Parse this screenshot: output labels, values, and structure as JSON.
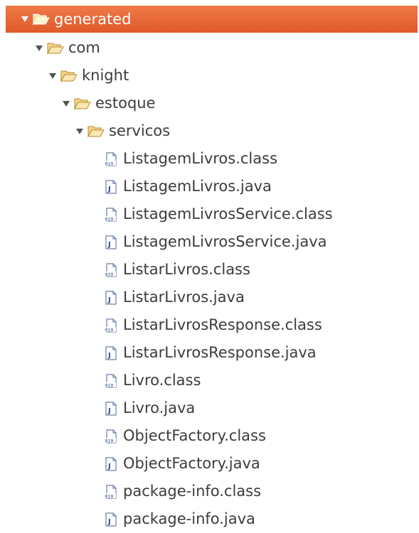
{
  "tree": {
    "root": {
      "label": "generated",
      "icon": "folder-open-icon",
      "expanded": true,
      "selected": true
    },
    "com": {
      "label": "com",
      "icon": "folder-open-icon",
      "expanded": true
    },
    "knight": {
      "label": "knight",
      "icon": "folder-open-icon",
      "expanded": true
    },
    "estoque": {
      "label": "estoque",
      "icon": "folder-open-icon",
      "expanded": true
    },
    "servicos": {
      "label": "servicos",
      "icon": "folder-open-icon",
      "expanded": true
    },
    "files": [
      {
        "label": "ListagemLivros.class",
        "icon": "class-file-icon"
      },
      {
        "label": "ListagemLivros.java",
        "icon": "java-file-icon"
      },
      {
        "label": "ListagemLivrosService.class",
        "icon": "class-file-icon"
      },
      {
        "label": "ListagemLivrosService.java",
        "icon": "java-file-icon"
      },
      {
        "label": "ListarLivros.class",
        "icon": "class-file-icon"
      },
      {
        "label": "ListarLivros.java",
        "icon": "java-file-icon"
      },
      {
        "label": "ListarLivrosResponse.class",
        "icon": "class-file-icon"
      },
      {
        "label": "ListarLivrosResponse.java",
        "icon": "java-file-icon"
      },
      {
        "label": "Livro.class",
        "icon": "class-file-icon"
      },
      {
        "label": "Livro.java",
        "icon": "java-file-icon"
      },
      {
        "label": "ObjectFactory.class",
        "icon": "class-file-icon"
      },
      {
        "label": "ObjectFactory.java",
        "icon": "java-file-icon"
      },
      {
        "label": "package-info.class",
        "icon": "class-file-icon"
      },
      {
        "label": "package-info.java",
        "icon": "java-file-icon"
      }
    ]
  },
  "colors": {
    "selection": "#e8643a",
    "text": "#3c3c3c",
    "folder": "#e9b458"
  }
}
